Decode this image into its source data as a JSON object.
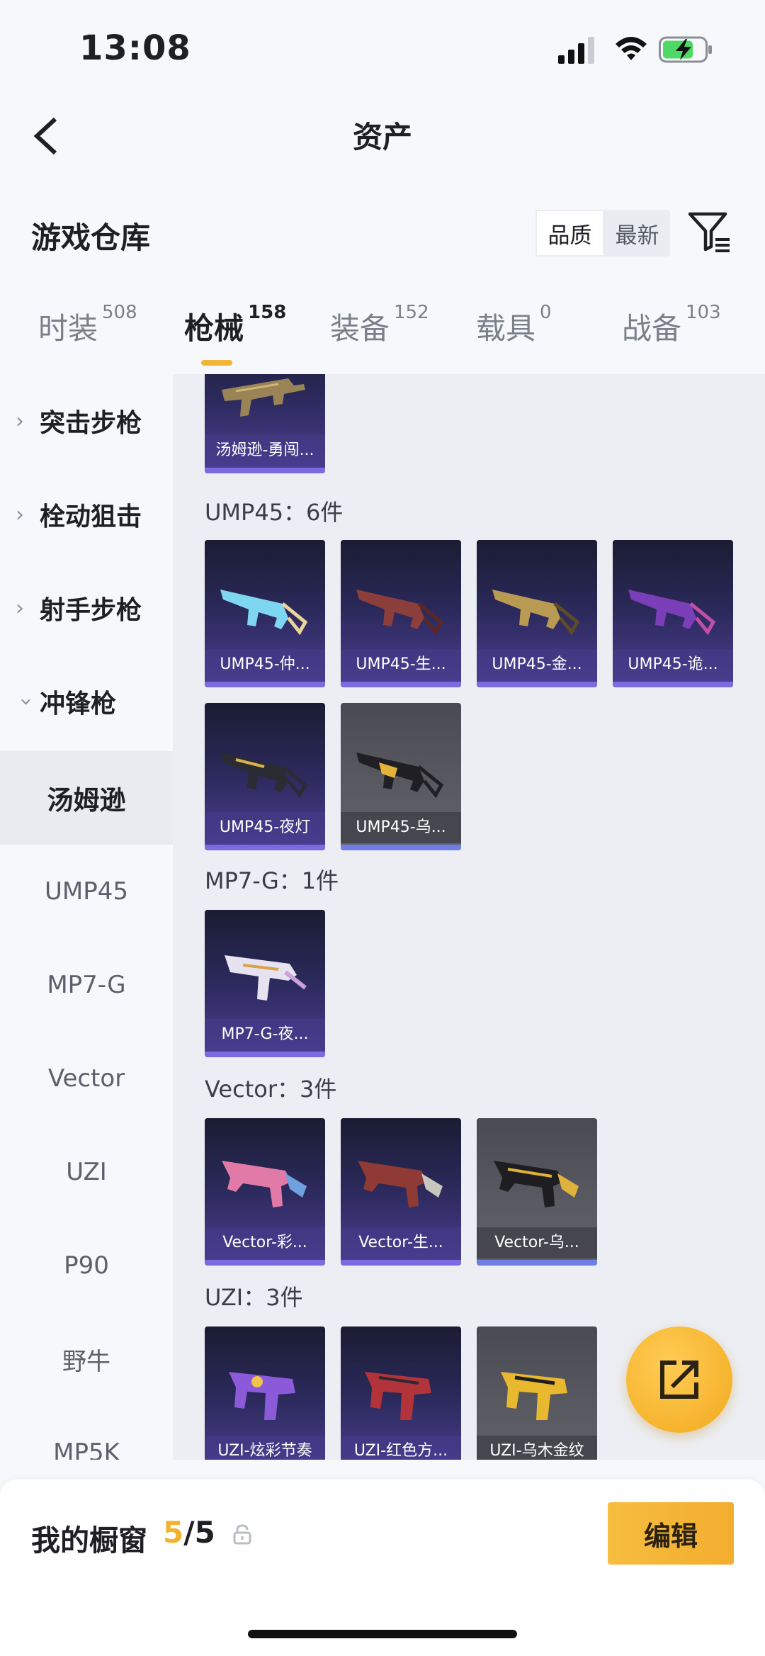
{
  "status": {
    "time": "13:08"
  },
  "nav": {
    "title": "资产"
  },
  "warehouse": {
    "title": "游戏仓库",
    "sort_options": [
      "品质",
      "最新"
    ],
    "sort_selected": "品质"
  },
  "tabs": [
    {
      "label": "时装",
      "count": "508"
    },
    {
      "label": "枪械",
      "count": "158"
    },
    {
      "label": "装备",
      "count": "152"
    },
    {
      "label": "载具",
      "count": "0"
    },
    {
      "label": "战备",
      "count": "103"
    }
  ],
  "sidebar": {
    "categories": [
      "突击步枪",
      "栓动狙击",
      "射手步枪",
      "冲锋枪"
    ],
    "subitems": [
      "汤姆逊",
      "UMP45",
      "MP7-G",
      "Vector",
      "UZI",
      "P90",
      "野牛",
      "MP5K"
    ],
    "selected_sub": "汤姆逊"
  },
  "groups": {
    "thompson": {
      "items": [
        "汤姆逊-勇闯..."
      ]
    },
    "ump45": {
      "title": "UMP45：6件",
      "items": [
        "UMP45-仲...",
        "UMP45-生...",
        "UMP45-金...",
        "UMP45-诡...",
        "UMP45-夜灯",
        "UMP45-乌..."
      ]
    },
    "mp7g": {
      "title": "MP7-G：1件",
      "items": [
        "MP7-G-夜..."
      ]
    },
    "vector": {
      "title": "Vector：3件",
      "items": [
        "Vector-彩...",
        "Vector-生...",
        "Vector-乌..."
      ]
    },
    "uzi": {
      "title": "UZI：3件",
      "items": [
        "UZI-炫彩节奏",
        "UZI-红色方...",
        "UZI-乌木金纹"
      ]
    }
  },
  "showcase": {
    "label": "我的橱窗",
    "current": "5",
    "total": "/5",
    "edit_label": "编辑"
  },
  "colors": {
    "accent": "#f3b43a",
    "rarity_purple": "#7b6be0",
    "rarity_blue": "#6e7ee6"
  }
}
